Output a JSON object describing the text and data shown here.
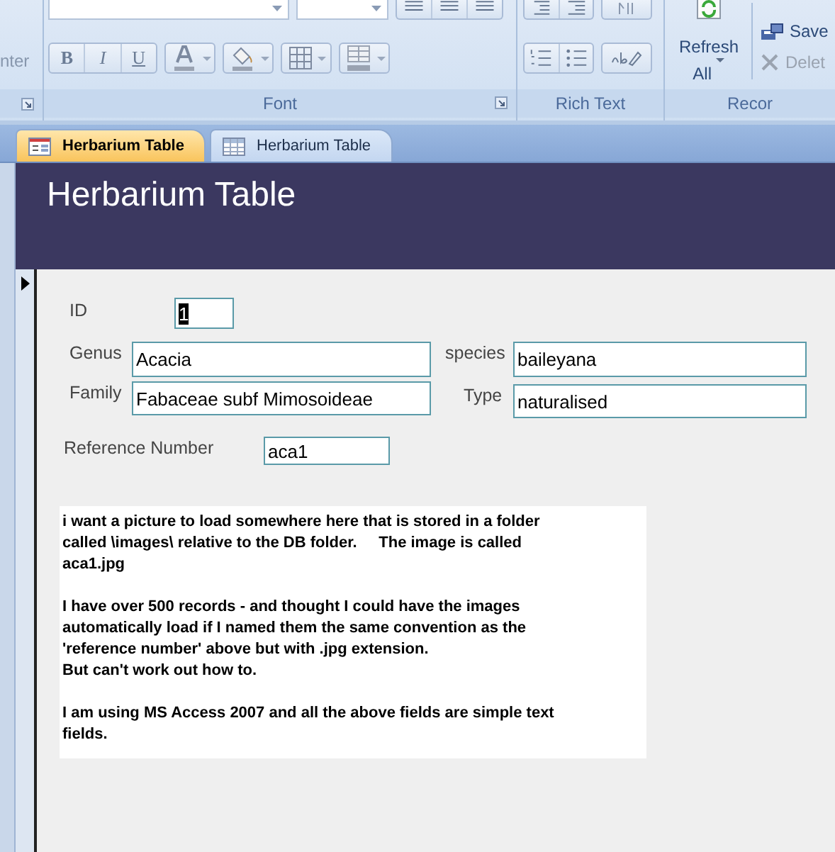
{
  "ribbon": {
    "left_group": {
      "button_label": "nter"
    },
    "font_group": {
      "label": "Font",
      "buttons": [
        {
          "kind": "bold",
          "glyph": "B"
        },
        {
          "kind": "italic",
          "glyph": "I"
        },
        {
          "kind": "underline",
          "glyph": "U"
        }
      ],
      "tools": [
        {
          "kind": "font_color"
        },
        {
          "kind": "fill_color"
        },
        {
          "kind": "gridlines"
        },
        {
          "kind": "alternate_fill"
        }
      ]
    },
    "rich_text_group": {
      "label": "Rich Text"
    },
    "records_group": {
      "label": "Recor",
      "refresh": [
        "Refresh",
        "All"
      ],
      "save": "Save",
      "delete": {
        "label": "Delet",
        "disabled": true
      }
    }
  },
  "tabs": [
    {
      "label": "Herbarium Table",
      "kind": "form",
      "selected": true
    },
    {
      "label": "Herbarium Table",
      "kind": "table",
      "selected": false
    }
  ],
  "form": {
    "title": "Herbarium Table",
    "fields": [
      {
        "label": "ID",
        "value": "1",
        "kind": "id"
      },
      {
        "label": "Genus",
        "value": "Acacia",
        "kind": "genus"
      },
      {
        "label": "Family",
        "value": "Fabaceae subf Mimosoideae",
        "kind": "family"
      },
      {
        "label": "species",
        "value": "baileyana",
        "kind": "species"
      },
      {
        "label": "Type",
        "value": "naturalised",
        "kind": "type"
      },
      {
        "label": "Reference Number",
        "value": "aca1",
        "kind": "reference"
      }
    ],
    "note": [
      [
        "i want a picture to load somewhere here that is stored in a folder",
        "called \\images\\ relative to the DB folder.     The image is called",
        "aca1.jpg"
      ],
      [
        "I have over 500 records - and thought I could have the images",
        "automatically load if I named them the same convention as the",
        "'reference number' above but with .jpg extension.",
        "But can't work out how to."
      ],
      [
        "I am using MS Access 2007 and all the above fields are simple text",
        "fields."
      ]
    ]
  }
}
